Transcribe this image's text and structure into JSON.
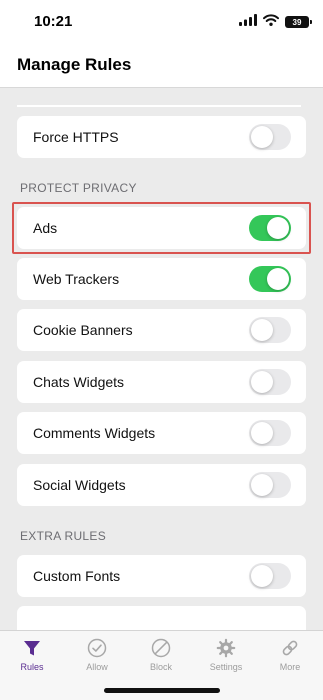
{
  "status_bar": {
    "time": "10:21",
    "battery": "39",
    "icons": [
      "cellular-signal-icon",
      "wifi-icon",
      "battery-icon"
    ]
  },
  "header": {
    "title": "Manage Rules"
  },
  "colors": {
    "toggle_on": "#34c759",
    "toggle_off": "#e9e9eb",
    "accent": "#5a2d91",
    "highlight": "#d9534f",
    "background": "#ebebeb"
  },
  "rows": {
    "force_https": {
      "label": "Force HTTPS",
      "enabled": false
    },
    "ads": {
      "label": "Ads",
      "enabled": true
    },
    "web_trackers": {
      "label": "Web Trackers",
      "enabled": true
    },
    "cookie_banners": {
      "label": "Cookie Banners",
      "enabled": false
    },
    "chats_widgets": {
      "label": "Chats Widgets",
      "enabled": false
    },
    "comments_widgets": {
      "label": "Comments Widgets",
      "enabled": false
    },
    "social_widgets": {
      "label": "Social Widgets",
      "enabled": false
    },
    "custom_fonts": {
      "label": "Custom Fonts",
      "enabled": false
    }
  },
  "sections": {
    "protect_privacy": "PROTECT PRIVACY",
    "extra_rules": "EXTRA RULES"
  },
  "tab_bar": {
    "active": "Rules",
    "tabs": [
      {
        "label": "Rules",
        "icon": "funnel-icon"
      },
      {
        "label": "Allow",
        "icon": "checkmark-circle-icon"
      },
      {
        "label": "Block",
        "icon": "block-icon"
      },
      {
        "label": "Settings",
        "icon": "gear-icon"
      },
      {
        "label": "More",
        "icon": "link-icon"
      }
    ]
  }
}
